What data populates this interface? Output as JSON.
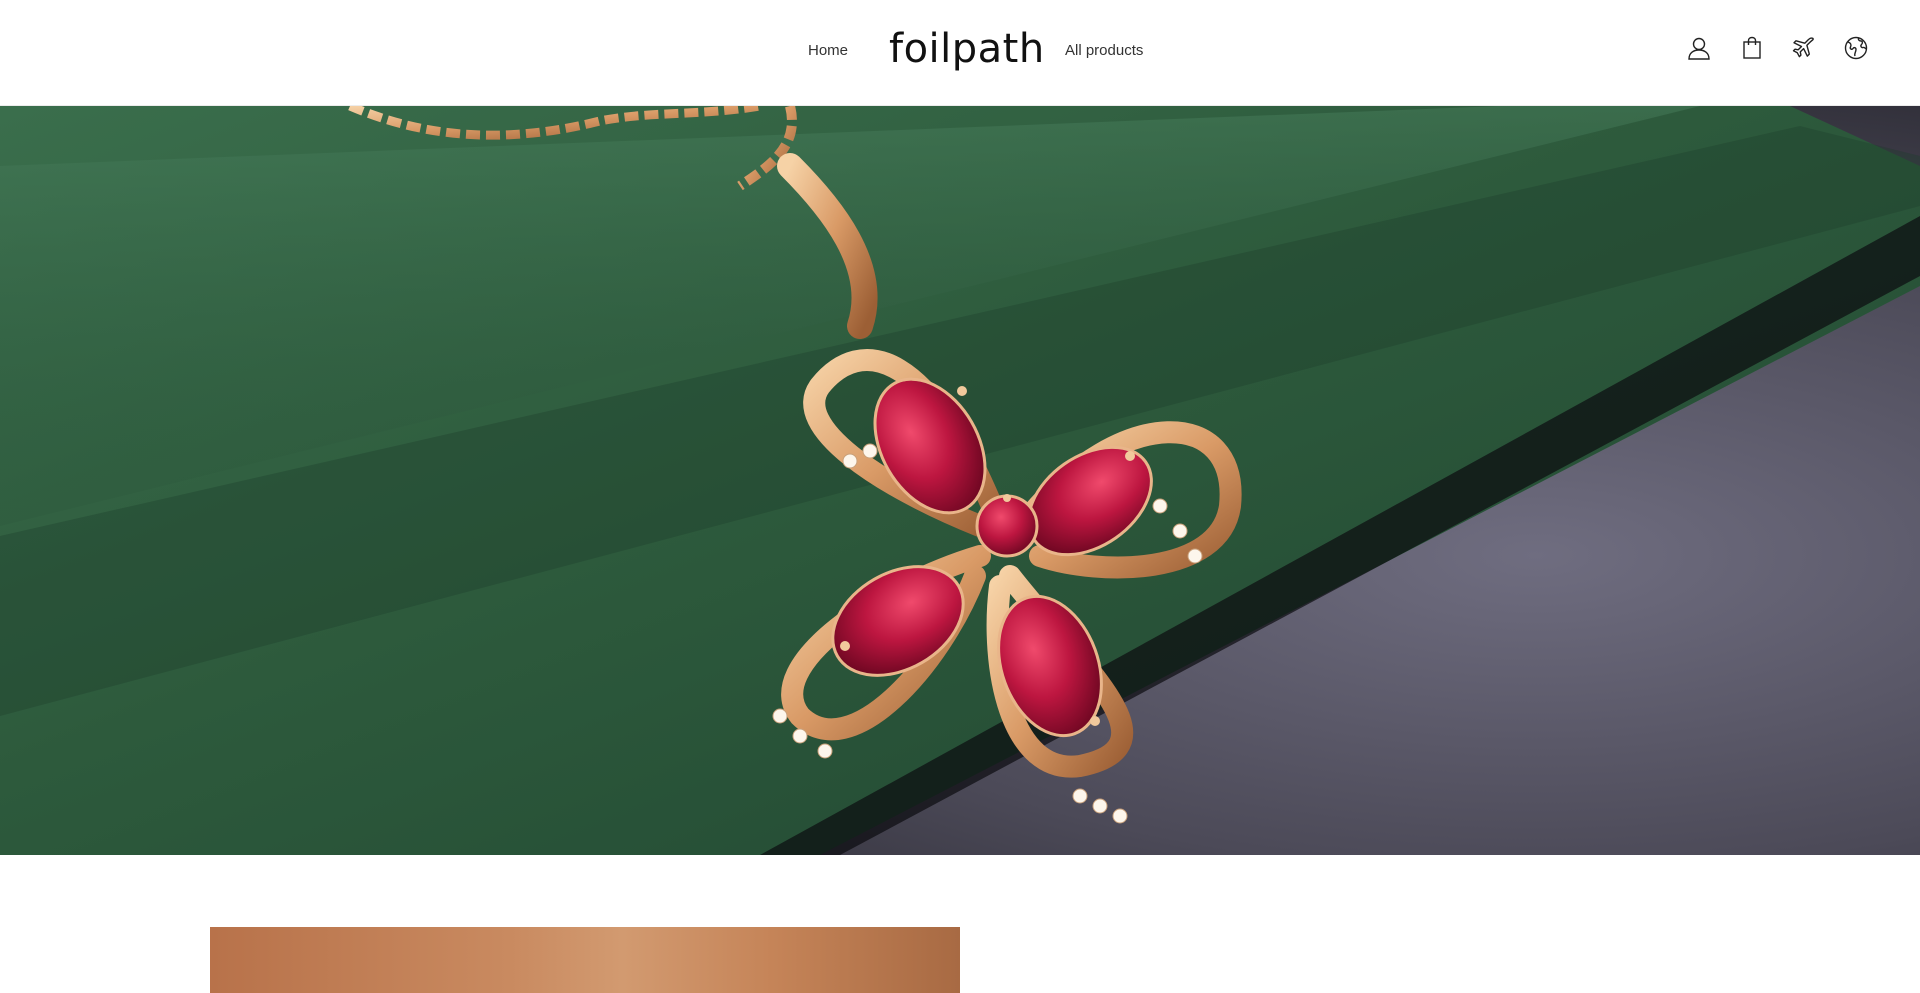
{
  "header": {
    "logo": "foilpath",
    "nav": {
      "home": "Home",
      "all_products": "All products"
    },
    "icons": [
      "account-icon",
      "cart-icon",
      "airplane-icon",
      "globe-icon"
    ]
  },
  "hero": {
    "image": "ruby-flower-pendant-on-green-satin",
    "colors": {
      "satin": "#2f5e3f",
      "surface": "#5a5868",
      "gold": "#d9a071",
      "ruby": "#b8163a"
    }
  },
  "featured": {
    "image": "product-image-skin-tone"
  }
}
